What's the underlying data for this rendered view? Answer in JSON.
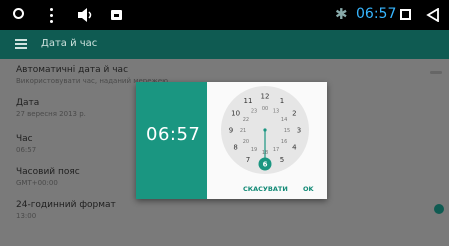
{
  "statusbar": {
    "time": "06:57",
    "bluetooth_glyph": "✱",
    "back_glyph": "◁"
  },
  "appbar": {
    "title": "Дата й час"
  },
  "settings": {
    "auto_date": {
      "title": "Автоматичні дата й час",
      "summary": "Використовувати час, наданий мережею"
    },
    "date": {
      "title": "Дата",
      "summary": "27 вересня 2013 р."
    },
    "time": {
      "title": "Час",
      "summary": "06:57"
    },
    "timezone": {
      "title": "Часовий пояс",
      "summary": "GMT+00:00"
    },
    "format24": {
      "title": "24-годинний формат",
      "summary": "13:00"
    }
  },
  "dialog": {
    "time": "06:57",
    "cancel_label": "СКАСУВАТИ",
    "ok_label": "OK",
    "selected_hour": "6",
    "outer_hours": [
      "12",
      "1",
      "2",
      "3",
      "4",
      "5",
      "6",
      "7",
      "8",
      "9",
      "10",
      "11"
    ],
    "inner_hours": [
      "00",
      "13",
      "14",
      "15",
      "16",
      "17",
      "18",
      "19",
      "20",
      "21",
      "22",
      "23"
    ],
    "accent_color": "#1a9681"
  }
}
